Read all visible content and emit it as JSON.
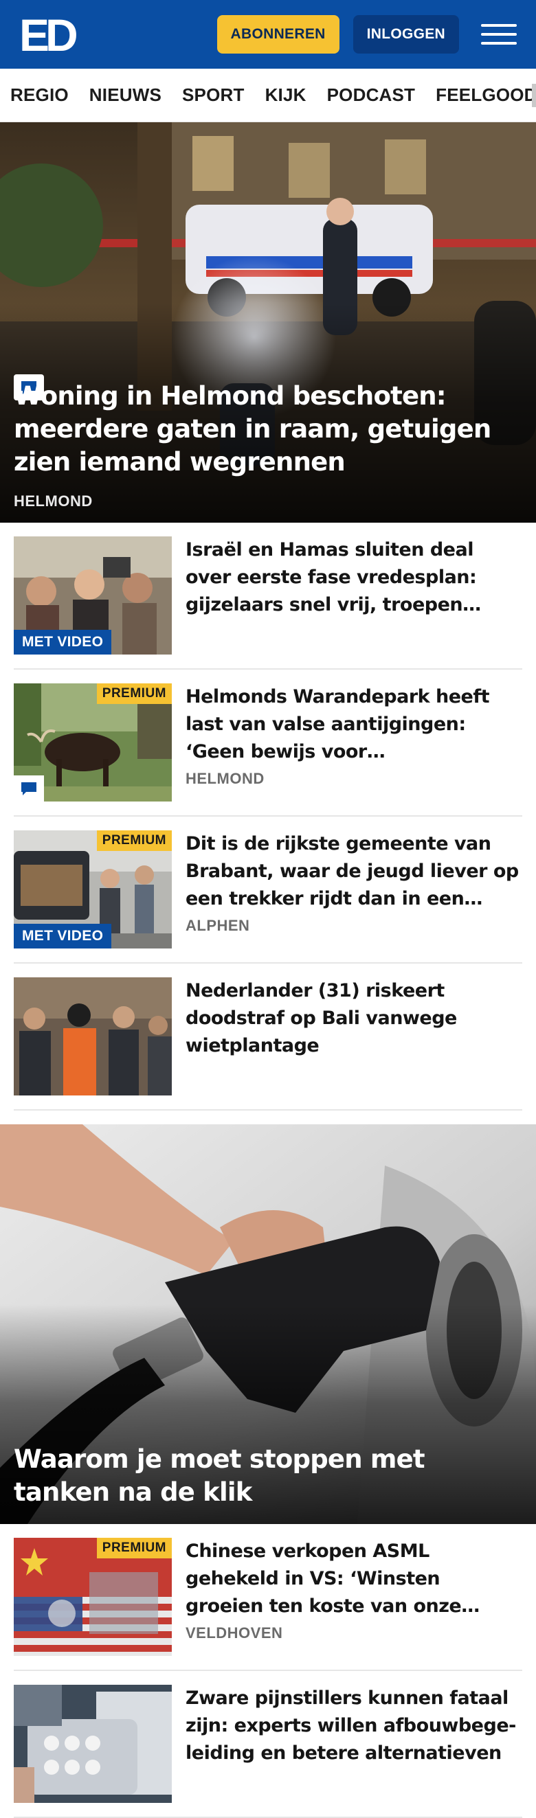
{
  "header": {
    "logo_text": "ED",
    "subscribe_label": "ABONNEREN",
    "login_label": "INLOGGEN",
    "menu_icon": "hamburger-menu-icon",
    "brand_color": "#0a4ea3",
    "accent_color": "#f6c232"
  },
  "nav": {
    "items": [
      "REGIO",
      "NIEUWS",
      "SPORT",
      "KIJK",
      "PODCAST",
      "FEELGOOD"
    ]
  },
  "hero": {
    "title": "Woning in Helmond beschoten: meerdere gaten in raam, getuigen zien iemand wegrennen",
    "tag": "HELMOND",
    "has_comments_icon": true
  },
  "articles_top": [
    {
      "title": "Israël en Hamas sluiten deal over eerste fase vredesplan: gijzelaars snel vrij, troepen weg…",
      "tag": "",
      "premium": false,
      "video": true,
      "video_label": "MET VIDEO",
      "comments": false
    },
    {
      "title": "Helmonds Warandepark heeft last van valse aantijgingen: ‘Geen bewijs voor verwaarloosde…",
      "tag": "HELMOND",
      "premium": true,
      "premium_label": "PREMIUM",
      "video": false,
      "comments": true
    },
    {
      "title": "Dit is de rijkste gemeente van Brabant, waar de jeugd liever op een trekker rijdt dan in een…",
      "tag": "ALPHEN",
      "premium": true,
      "premium_label": "PREMIUM",
      "video": true,
      "video_label": "MET VIDEO",
      "comments": false
    },
    {
      "title": "Nederlander (31) riskeert doodstraf op Bali vanwege wietplantage",
      "tag": "",
      "premium": false,
      "video": false,
      "comments": false
    }
  ],
  "hero2": {
    "title": "Waarom je moet stoppen met tanken na de klik"
  },
  "articles_bottom": [
    {
      "title": "Chinese verkopen ASML gehekeld in VS: ‘Winsten groeien ten koste van onze nationale…",
      "tag": "VELDHOVEN",
      "premium": true,
      "premium_label": "PREMIUM"
    },
    {
      "title": "Zware pijnstillers kunnen fataal zijn: experts willen afbouwbege­leiding en betere alternatieven",
      "tag": "",
      "premium": false
    }
  ]
}
